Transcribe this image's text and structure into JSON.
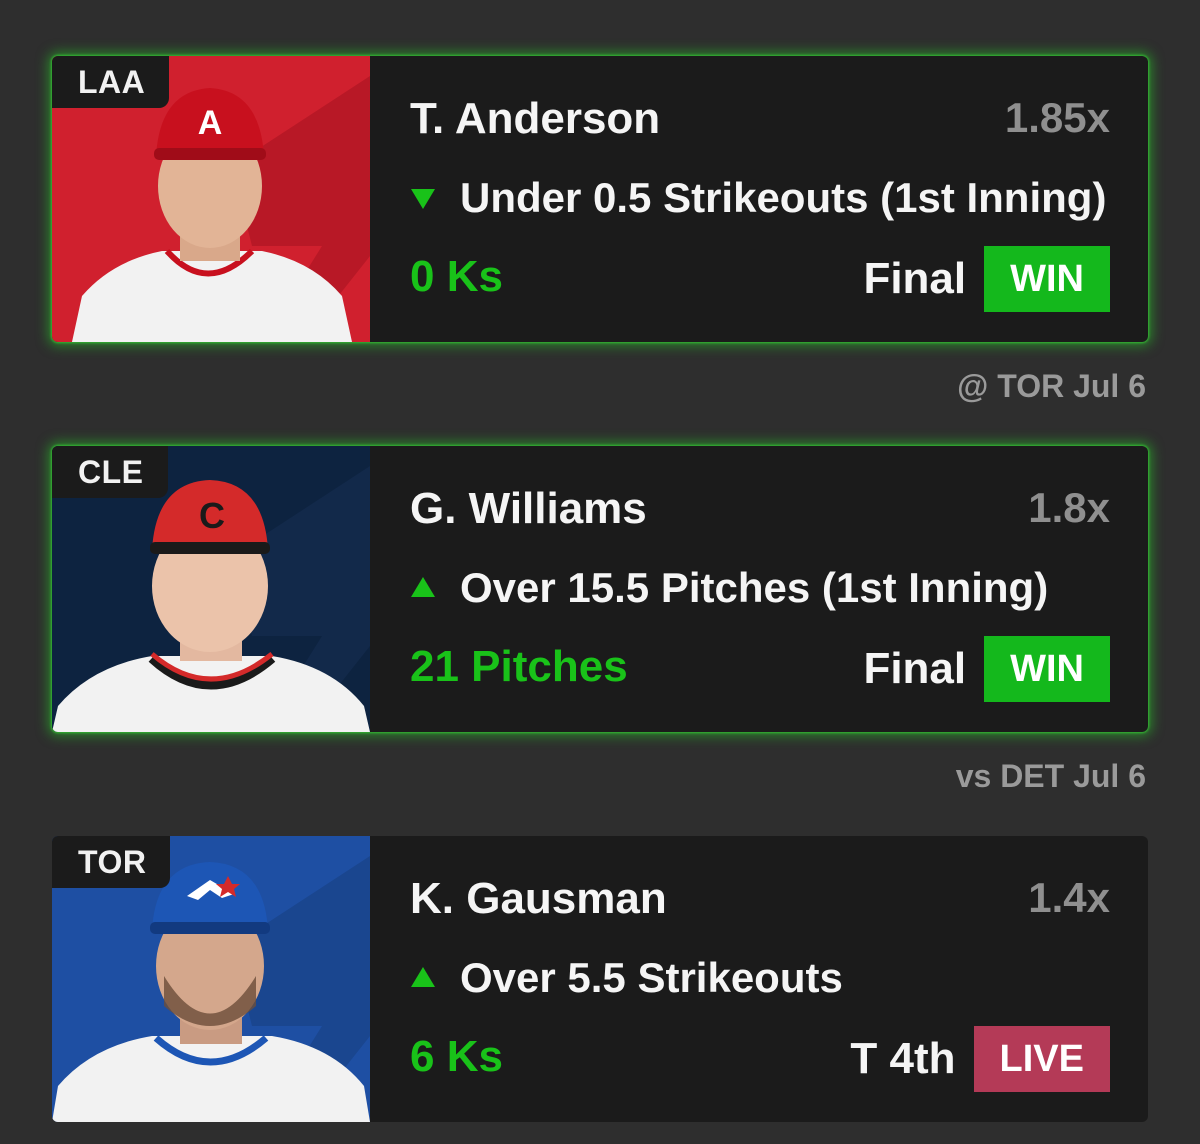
{
  "picks": [
    {
      "team": "LAA",
      "player": "T. Anderson",
      "multiplier": "1.85x",
      "direction": "down",
      "pick": "Under 0.5 Strikeouts (1st Inning)",
      "result": "0 Ks",
      "status": "Final",
      "badge": "WIN",
      "game": "@ TOR Jul 6",
      "photo_bg": "#d0202e",
      "cap_color": "#c8101e"
    },
    {
      "team": "CLE",
      "player": "G. Williams",
      "multiplier": "1.8x",
      "direction": "up",
      "pick": "Over 15.5 Pitches (1st Inning)",
      "result": "21 Pitches",
      "status": "Final",
      "badge": "WIN",
      "game": "vs DET Jul 6",
      "photo_bg": "#0d2340",
      "cap_color": "#d42a2a"
    },
    {
      "team": "TOR",
      "player": "K. Gausman",
      "multiplier": "1.4x",
      "direction": "up",
      "pick": "Over 5.5 Strikeouts",
      "result": "6 Ks",
      "status": "T 4th",
      "badge": "LIVE",
      "photo_bg": "#1e4fa3",
      "cap_color": "#1d56b5"
    }
  ],
  "colors": {
    "win_green": "#14b81c",
    "live_red": "#b43a57",
    "result_green": "#19c219",
    "glow_green": "#28c828"
  },
  "icons": {
    "down": "triangle-down-icon",
    "up": "triangle-up-icon"
  }
}
